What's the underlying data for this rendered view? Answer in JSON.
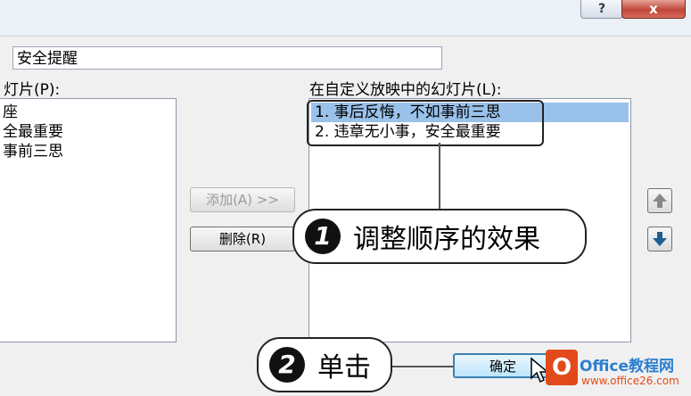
{
  "window": {
    "help_label": "?",
    "close_label": "x"
  },
  "show_name": {
    "value": "安全提醒"
  },
  "left_list": {
    "label": "灯片(P):",
    "items": [
      "座",
      "全最重要",
      "事前三思"
    ]
  },
  "right_list": {
    "label": "在自定义放映中的幻灯片(L):",
    "items": [
      "1.  事后反悔，不如事前三思",
      "2.  违章无小事，安全最重要"
    ]
  },
  "buttons": {
    "add": "添加(A) >>",
    "remove": "删除(R)",
    "ok": "确定"
  },
  "callouts": {
    "one_num": "1",
    "one_text": "调整顺序的效果",
    "two_num": "2",
    "two_text": "单击"
  },
  "watermark": {
    "brand": "Office教程网",
    "url": "www.office26.com"
  },
  "colors": {
    "selection": "#99c1ea",
    "close": "#c0463a"
  }
}
